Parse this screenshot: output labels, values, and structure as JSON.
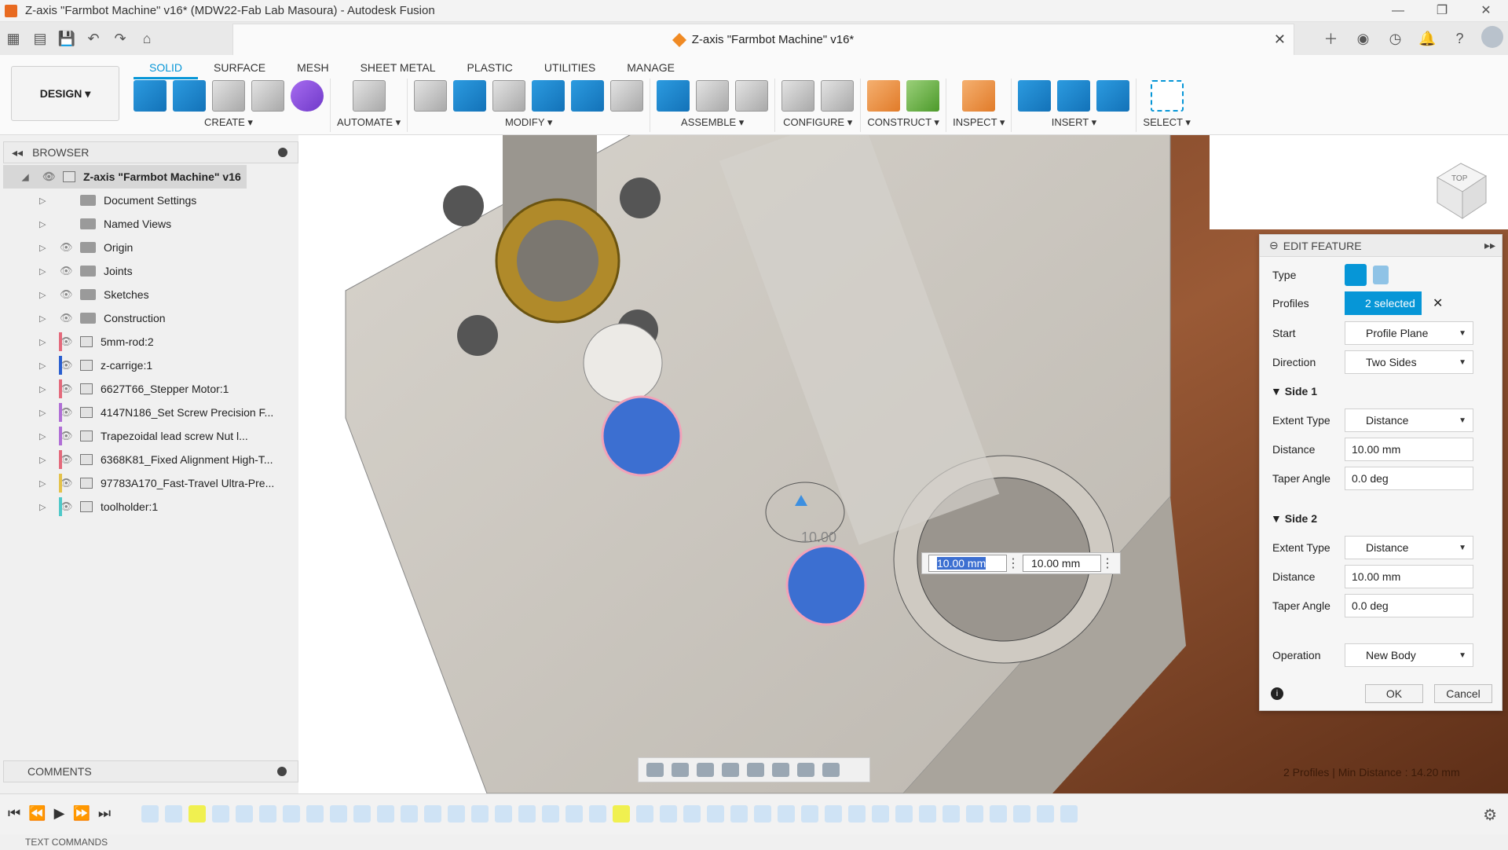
{
  "window": {
    "title": "Z-axis \"Farmbot Machine\" v16* (MDW22-Fab Lab Masoura) - Autodesk Fusion"
  },
  "document_tab": {
    "title": "Z-axis \"Farmbot Machine\" v16*"
  },
  "ribbon": {
    "workspace": "DESIGN ▾",
    "tabs": [
      "SOLID",
      "SURFACE",
      "MESH",
      "SHEET METAL",
      "PLASTIC",
      "UTILITIES",
      "MANAGE"
    ],
    "groups": [
      "CREATE ▾",
      "AUTOMATE ▾",
      "MODIFY ▾",
      "ASSEMBLE ▾",
      "CONFIGURE ▾",
      "CONSTRUCT ▾",
      "INSPECT ▾",
      "INSERT ▾",
      "SELECT ▾"
    ]
  },
  "browser": {
    "title": "BROWSER",
    "root": "Z-axis \"Farmbot Machine\" v16",
    "items": [
      {
        "label": "Document Settings",
        "color": ""
      },
      {
        "label": "Named Views",
        "color": ""
      },
      {
        "label": "Origin",
        "color": ""
      },
      {
        "label": "Joints",
        "color": ""
      },
      {
        "label": "Sketches",
        "color": ""
      },
      {
        "label": "Construction",
        "color": ""
      },
      {
        "label": "5mm-rod:2",
        "color": "#e46a7c"
      },
      {
        "label": "z-carrige:1",
        "color": "#2a5fd0"
      },
      {
        "label": "6627T66_Stepper Motor:1",
        "color": "#e46a7c"
      },
      {
        "label": "4147N186_Set Screw Precision F...",
        "color": "#b06fd6"
      },
      {
        "label": "Trapezoidal lead screw Nut l...",
        "color": "#b06fd6"
      },
      {
        "label": "6368K81_Fixed Alignment High-T...",
        "color": "#e46a7c"
      },
      {
        "label": "97783A170_Fast-Travel Ultra-Pre...",
        "color": "#e4c24a"
      },
      {
        "label": "toolholder:1",
        "color": "#4fc9c9"
      }
    ]
  },
  "comments": {
    "title": "COMMENTS"
  },
  "edit_feature": {
    "title": "EDIT FEATURE",
    "type_label": "Type",
    "profiles_label": "Profiles",
    "profiles_value": "2 selected",
    "start_label": "Start",
    "start_value": "Profile Plane",
    "direction_label": "Direction",
    "direction_value": "Two Sides",
    "side1": {
      "title": "Side 1",
      "extent_label": "Extent Type",
      "extent_value": "Distance",
      "distance_label": "Distance",
      "distance_value": "10.00 mm",
      "taper_label": "Taper Angle",
      "taper_value": "0.0 deg"
    },
    "side2": {
      "title": "Side 2",
      "extent_label": "Extent Type",
      "extent_value": "Distance",
      "distance_label": "Distance",
      "distance_value": "10.00 mm",
      "taper_label": "Taper Angle",
      "taper_value": "0.0 deg"
    },
    "operation_label": "Operation",
    "operation_value": "New Body",
    "ok": "OK",
    "cancel": "Cancel"
  },
  "viewport": {
    "dim1": "10.00 mm",
    "dim2": "10.00 mm",
    "sketch_dim": "10.00",
    "status": "2 Profiles | Min Distance : 14.20 mm"
  },
  "viewcube": {
    "face": "TOP"
  },
  "text_commands": "TEXT COMMANDS"
}
